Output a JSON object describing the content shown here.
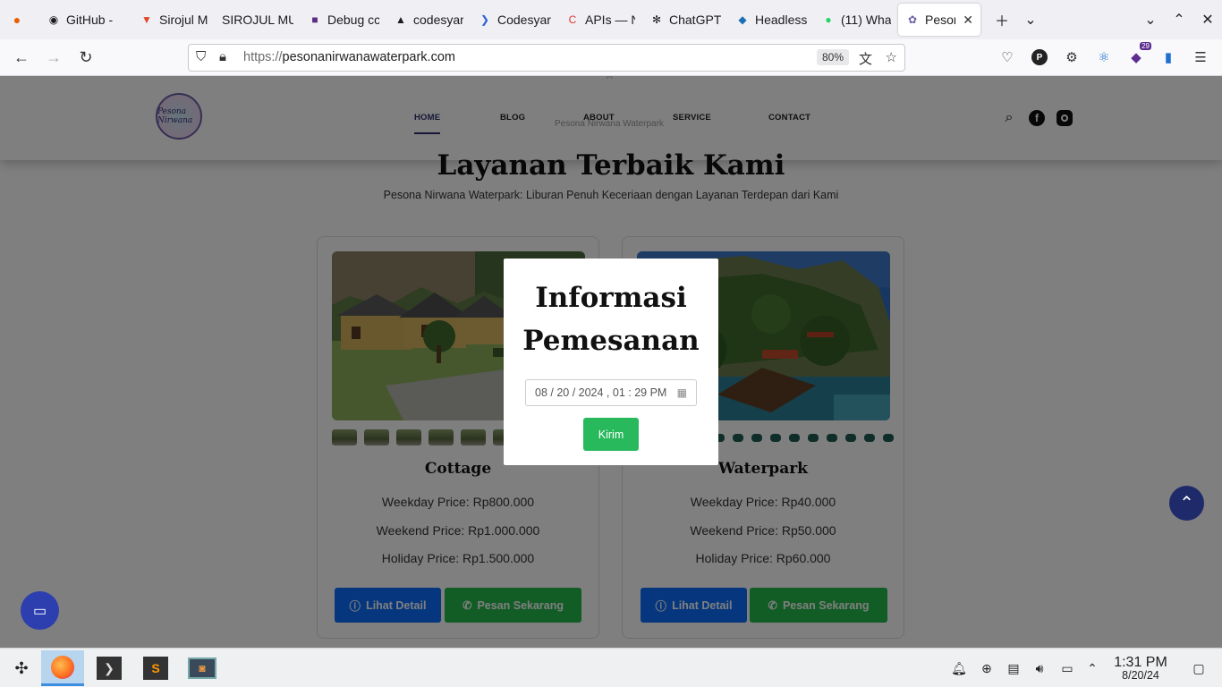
{
  "browser": {
    "tabs": [
      {
        "label": "",
        "icon": "firefox-icon"
      },
      {
        "label": "GitHub -",
        "icon": "github-icon"
      },
      {
        "label": "Sirojul M",
        "icon": "gitlab-icon"
      },
      {
        "label": "SIROJUL MU",
        "icon": ""
      },
      {
        "label": "Debug cc",
        "icon": "debug-icon"
      },
      {
        "label": "codesyar",
        "icon": "codesyar-icon"
      },
      {
        "label": "Codesyar",
        "icon": "codesyar2-icon"
      },
      {
        "label": "APIs — N",
        "icon": "apis-icon"
      },
      {
        "label": "ChatGPT",
        "icon": "chatgpt-icon"
      },
      {
        "label": "Headless",
        "icon": "headless-icon"
      },
      {
        "label": "(11) Wha",
        "icon": "whatsapp-icon"
      },
      {
        "label": "Peson",
        "icon": "pesona-icon",
        "active": true
      }
    ],
    "url_protocol": "https://",
    "url_domain": "pesonanirwanawaterpark.com",
    "zoom": "80%",
    "extension_badge": "29"
  },
  "site": {
    "nav": [
      "HOME",
      "BLOG",
      "ABOUT",
      "SERVICE",
      "CONTACT"
    ],
    "logo_text": "Pesona Nirwana",
    "ghost_text": "Pesona Nirwana Waterpark",
    "section_title": "Layanan Terbaik Kami",
    "section_subtitle": "Pesona Nirwana Waterpark: Liburan Penuh Keceriaan dengan Layanan Terdepan dari Kami",
    "cards": [
      {
        "title": "Cottage",
        "weekday": "Weekday Price: Rp800.000",
        "weekend": "Weekend Price: Rp1.000.000",
        "holiday": "Holiday Price: Rp1.500.000",
        "detail_label": "Lihat Detail",
        "order_label": "Pesan Sekarang"
      },
      {
        "title": "Waterpark",
        "weekday": "Weekday Price: Rp40.000",
        "weekend": "Weekend Price: Rp50.000",
        "holiday": "Holiday Price: Rp60.000",
        "detail_label": "Lihat Detail",
        "order_label": "Pesan Sekarang"
      }
    ]
  },
  "modal": {
    "title_line1": "Informasi",
    "title_line2": "Pemesanan",
    "datetime_value": "08 / 20 / 2024 ,  01 : 29   PM",
    "submit_label": "Kirim"
  },
  "taskbar": {
    "time": "1:31 PM",
    "date": "8/20/24"
  },
  "colors": {
    "brand_primary": "#2d2e6e",
    "detail_button": "#0d6efd",
    "order_button": "#25b94b",
    "submit_button": "#28b95d",
    "scroll_top": "#1f2a6b"
  }
}
